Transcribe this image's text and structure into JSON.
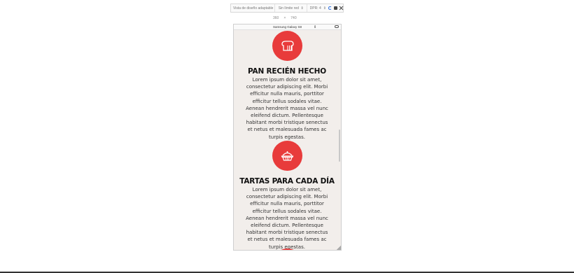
{
  "devtools": {
    "device_mode": "Vista de diseño adaptable",
    "network": "Sin límite red",
    "dpr": "DPR: 4",
    "width": "360",
    "height": "740",
    "times": "×",
    "device_name": "Samsung Galaxy S8",
    "icons": [
      "rotate-icon",
      "camera-icon",
      "close-icon"
    ]
  },
  "sections": [
    {
      "icon": "bread-icon",
      "title": "PAN RECIÉN HECHO",
      "text": "Lorem ipsum dolor sit amet, consectetur adipiscing elit. Morbi efficitur nulla mauris, porttitor efficitur tellus sodales vitae. Aenean hendrerit massa vel nunc eleifend dictum. Pellentesque habitant morbi tristique senectus et netus et malesuada fames ac turpis egestas."
    },
    {
      "icon": "pie-icon",
      "title": "TARTAS PARA CADA DÍA",
      "text": "Lorem ipsum dolor sit amet, consectetur adipiscing elit. Morbi efficitur nulla mauris, porttitor efficitur tellus sodales vitae. Aenean hendrerit massa vel nunc eleifend dictum. Pellentesque habitant morbi tristique senectus et netus et malesuada fames ac turpis egestas."
    }
  ],
  "colors": {
    "accent": "#e83b3b",
    "page_bg": "#f2eeeb"
  }
}
